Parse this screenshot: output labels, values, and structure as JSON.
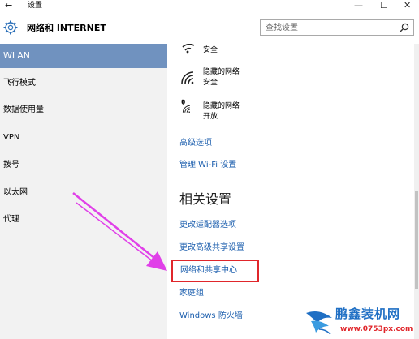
{
  "window": {
    "back_label": "←",
    "title": "设置",
    "minimize_label": "—",
    "maximize_label": "☐",
    "close_label": "✕"
  },
  "header": {
    "title": "网络和 INTERNET",
    "search_placeholder": "查找设置"
  },
  "sidebar": {
    "items": [
      {
        "label": "WLAN",
        "selected": true
      },
      {
        "label": "飞行模式"
      },
      {
        "label": "数据使用量"
      },
      {
        "label": "VPN"
      },
      {
        "label": "拨号"
      },
      {
        "label": "以太网"
      },
      {
        "label": "代理"
      }
    ]
  },
  "networks": [
    {
      "line1": "安全",
      "line2": ""
    },
    {
      "line1": "隐藏的网络",
      "line2": "安全"
    },
    {
      "line1": "隐藏的网络",
      "line2": "开放"
    }
  ],
  "links": {
    "advanced": "高级选项",
    "manage_wifi": "管理 Wi-Fi 设置"
  },
  "related": {
    "heading": "相关设置",
    "adapter": "更改适配器选项",
    "advanced_sharing": "更改高级共享设置",
    "network_center": "网络和共享中心",
    "homegroup": "家庭组",
    "firewall": "Windows 防火墙"
  },
  "watermark": {
    "title": "鹏鑫装机网",
    "url": "www.0753px.com"
  },
  "colors": {
    "selected_bg": "#7092bf",
    "link": "#1a5dad",
    "highlight": "#e0262b",
    "arrow": "#e040e8"
  }
}
